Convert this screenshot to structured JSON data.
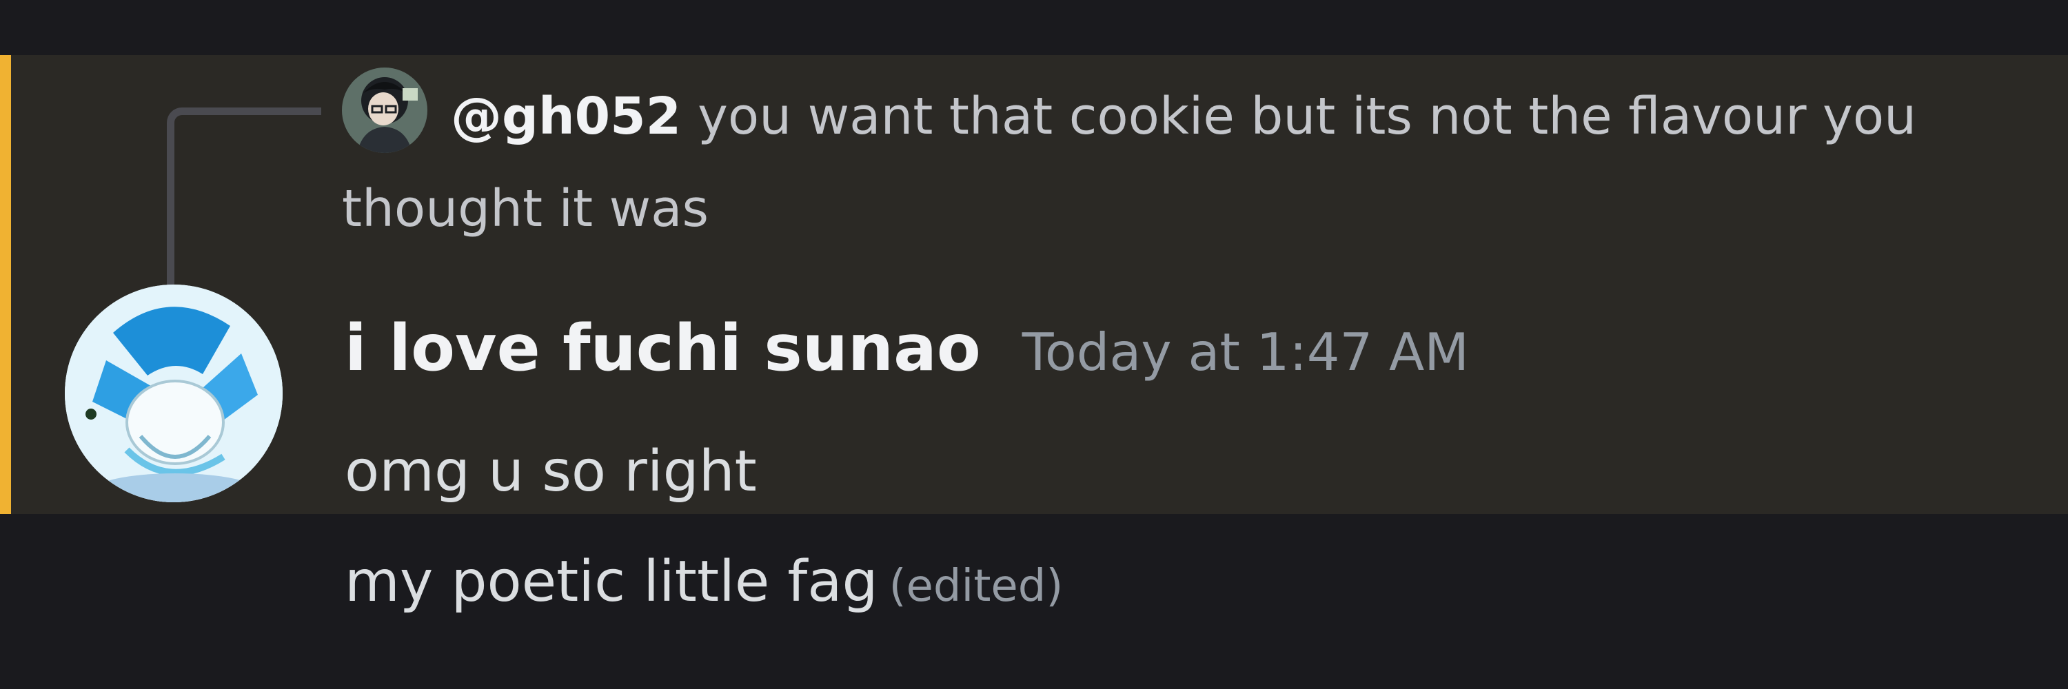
{
  "reply": {
    "author": "@gh052",
    "text": "you want that cookie but its not the flavour you thought it was"
  },
  "message": {
    "author": "i love fuchi sunao",
    "timestamp": "Today at 1:47 AM",
    "body": "omg u so right"
  },
  "followup": {
    "text": "my poetic little fag",
    "edited_label": "(edited)"
  },
  "colors": {
    "background": "#1a1a1e",
    "mention_highlight": "#2b2925",
    "mention_bar": "#f0b232",
    "username": "#f2f3f5",
    "timestamp": "#949ba4",
    "body_text": "#dbdee1"
  }
}
